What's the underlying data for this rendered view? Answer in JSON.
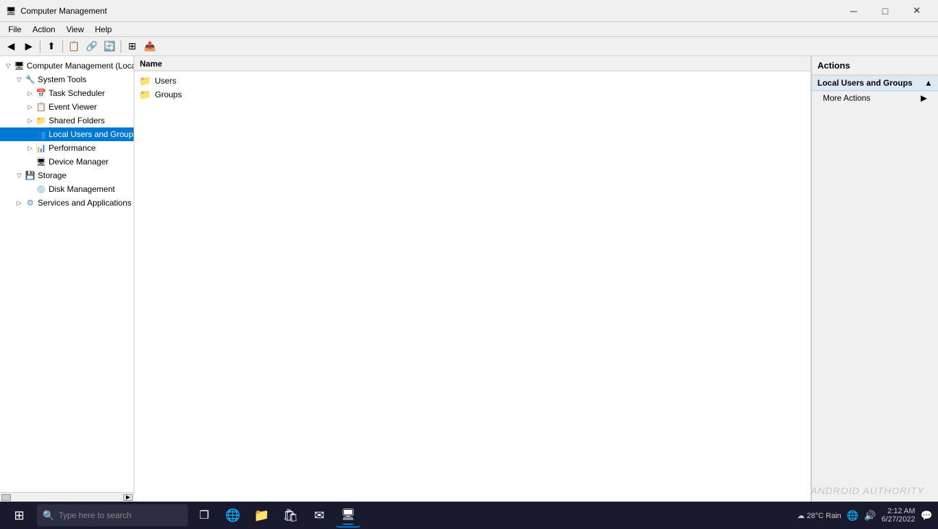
{
  "titleBar": {
    "title": "Computer Management",
    "icon": "🖥",
    "minimizeLabel": "─",
    "maximizeLabel": "□",
    "closeLabel": "✕"
  },
  "menuBar": {
    "items": [
      "File",
      "Action",
      "View",
      "Help"
    ]
  },
  "toolbar": {
    "buttons": [
      "←",
      "→",
      "⬆",
      "📋",
      "🔗",
      "⚙",
      "🖼"
    ]
  },
  "treePanel": {
    "items": [
      {
        "id": "computer-management",
        "label": "Computer Management (Local",
        "level": 1,
        "hasExpand": true,
        "expanded": true,
        "icon": "🖥",
        "iconColor": "#333"
      },
      {
        "id": "system-tools",
        "label": "System Tools",
        "level": 2,
        "hasExpand": true,
        "expanded": true,
        "icon": "🔧",
        "iconColor": "#4a90d9"
      },
      {
        "id": "task-scheduler",
        "label": "Task Scheduler",
        "level": 3,
        "hasExpand": true,
        "expanded": false,
        "icon": "📅",
        "iconColor": "#4a90d9"
      },
      {
        "id": "event-viewer",
        "label": "Event Viewer",
        "level": 3,
        "hasExpand": true,
        "expanded": false,
        "icon": "📋",
        "iconColor": "#4a90d9"
      },
      {
        "id": "shared-folders",
        "label": "Shared Folders",
        "level": 3,
        "hasExpand": true,
        "expanded": false,
        "icon": "📁",
        "iconColor": "#4a90d9"
      },
      {
        "id": "local-users-groups",
        "label": "Local Users and Groups",
        "level": 3,
        "hasExpand": false,
        "expanded": true,
        "icon": "👥",
        "iconColor": "#4a90d9",
        "selected": true
      },
      {
        "id": "performance",
        "label": "Performance",
        "level": 3,
        "hasExpand": true,
        "expanded": false,
        "icon": "📊",
        "iconColor": "#4a90d9"
      },
      {
        "id": "device-manager",
        "label": "Device Manager",
        "level": 3,
        "hasExpand": false,
        "expanded": false,
        "icon": "🖥",
        "iconColor": "#333"
      },
      {
        "id": "storage",
        "label": "Storage",
        "level": 2,
        "hasExpand": true,
        "expanded": true,
        "icon": "💾",
        "iconColor": "#4a90d9"
      },
      {
        "id": "disk-management",
        "label": "Disk Management",
        "level": 3,
        "hasExpand": false,
        "expanded": false,
        "icon": "💿",
        "iconColor": "#333"
      },
      {
        "id": "services-applications",
        "label": "Services and Applications",
        "level": 2,
        "hasExpand": true,
        "expanded": false,
        "icon": "⚙",
        "iconColor": "#4a90d9"
      }
    ]
  },
  "centerPanel": {
    "header": "Name",
    "items": [
      {
        "id": "users",
        "label": "Users",
        "icon": "📁",
        "iconColor": "#e8a000"
      },
      {
        "id": "groups",
        "label": "Groups",
        "icon": "📁",
        "iconColor": "#e8a000"
      }
    ]
  },
  "actionsPanel": {
    "header": "Actions",
    "sections": [
      {
        "id": "local-users-groups-section",
        "label": "Local Users and Groups",
        "items": [
          "More Actions"
        ]
      }
    ],
    "moreActionsArrow": "▶"
  },
  "statusBar": {
    "text": ""
  },
  "taskbar": {
    "startIcon": "⊞",
    "searchPlaceholder": "Type here to search",
    "apps": [
      {
        "id": "search",
        "icon": "🔍",
        "active": false
      },
      {
        "id": "taskview",
        "icon": "❐",
        "active": false
      },
      {
        "id": "edge",
        "icon": "🌐",
        "active": false
      },
      {
        "id": "explorer",
        "icon": "📁",
        "active": false
      },
      {
        "id": "store",
        "icon": "🛍",
        "active": false
      },
      {
        "id": "mail",
        "icon": "✉",
        "active": false
      },
      {
        "id": "compmanage",
        "icon": "🖥",
        "active": true
      }
    ],
    "systemTray": {
      "weather": "28°C Rain",
      "time": "2:12 AM",
      "date": "6/27/2022"
    }
  },
  "watermark": "ANDROID AUTHORITY"
}
